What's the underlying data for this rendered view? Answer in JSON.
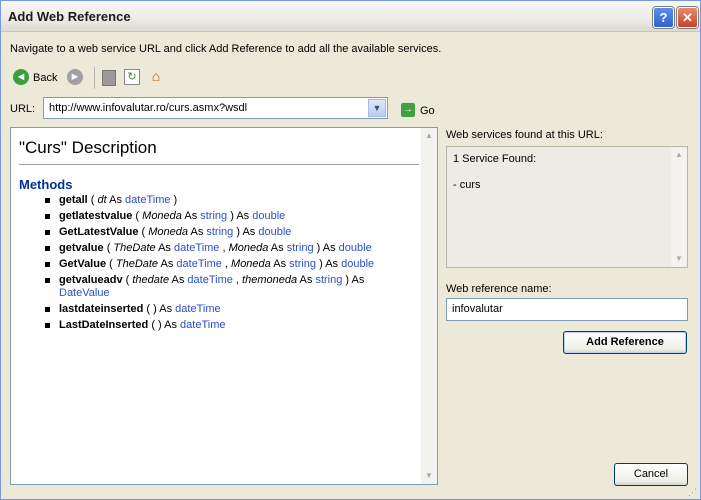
{
  "window": {
    "title": "Add Web Reference",
    "help_label": "?",
    "close_label": "✕"
  },
  "instruction": "Navigate to a web service URL and click Add Reference to add all the available services.",
  "toolbar": {
    "back_label": "Back",
    "back_icon": "back-arrow-icon",
    "forward_icon": "forward-arrow-icon",
    "stop_icon": "stop-icon",
    "refresh_icon": "refresh-icon",
    "home_icon": "home-icon"
  },
  "url": {
    "label": "URL:",
    "value": "http://www.infovalutar.ro/curs.asmx?wsdl",
    "go_label": "Go"
  },
  "browser": {
    "heading": "\"Curs\" Description",
    "methods_title": "Methods",
    "methods": [
      {
        "name": "getall",
        "sig_open": " ( ",
        "p1": "dt",
        "as1": " As ",
        "t1": "dateTime",
        "rest": " )"
      },
      {
        "name": "getlatestvalue",
        "sig_open": " ( ",
        "p1": "Moneda",
        "as1": " As ",
        "t1": "string",
        "close": " ) As ",
        "ret": "double"
      },
      {
        "name": "GetLatestValue",
        "sig_open": " ( ",
        "p1": "Moneda",
        "as1": " As ",
        "t1": "string",
        "close": " ) As ",
        "ret": "double"
      },
      {
        "name": "getvalue",
        "sig_open": " ( ",
        "p1": "TheDate",
        "as1": " As ",
        "t1": "dateTime",
        "comma": " , ",
        "p2": "Moneda",
        "as2": " As ",
        "t2": "string",
        "close": " ) As ",
        "ret": "double"
      },
      {
        "name": "GetValue",
        "sig_open": " ( ",
        "p1": "TheDate",
        "as1": " As ",
        "t1": "dateTime",
        "comma": " , ",
        "p2": "Moneda",
        "as2": " As ",
        "t2": "string",
        "close": " ) As ",
        "ret": "double"
      },
      {
        "name": "getvalueadv",
        "sig_open": " ( ",
        "p1": "thedate",
        "as1": " As ",
        "t1": "dateTime",
        "comma": " , ",
        "p2": "themoneda",
        "as2": " As ",
        "t2": "string",
        "close": " ) As ",
        "ret": "DateValue"
      },
      {
        "name": "lastdateinserted",
        "close": " ( ) As ",
        "ret": "dateTime"
      },
      {
        "name": "LastDateInserted",
        "close": " ( ) As ",
        "ret": "dateTime"
      }
    ]
  },
  "found": {
    "label": "Web services found at this URL:",
    "line1": "1 Service Found:",
    "line2": "- curs"
  },
  "reference": {
    "label": "Web reference name:",
    "value": "infovalutar"
  },
  "buttons": {
    "add_reference": "Add Reference",
    "cancel": "Cancel"
  }
}
